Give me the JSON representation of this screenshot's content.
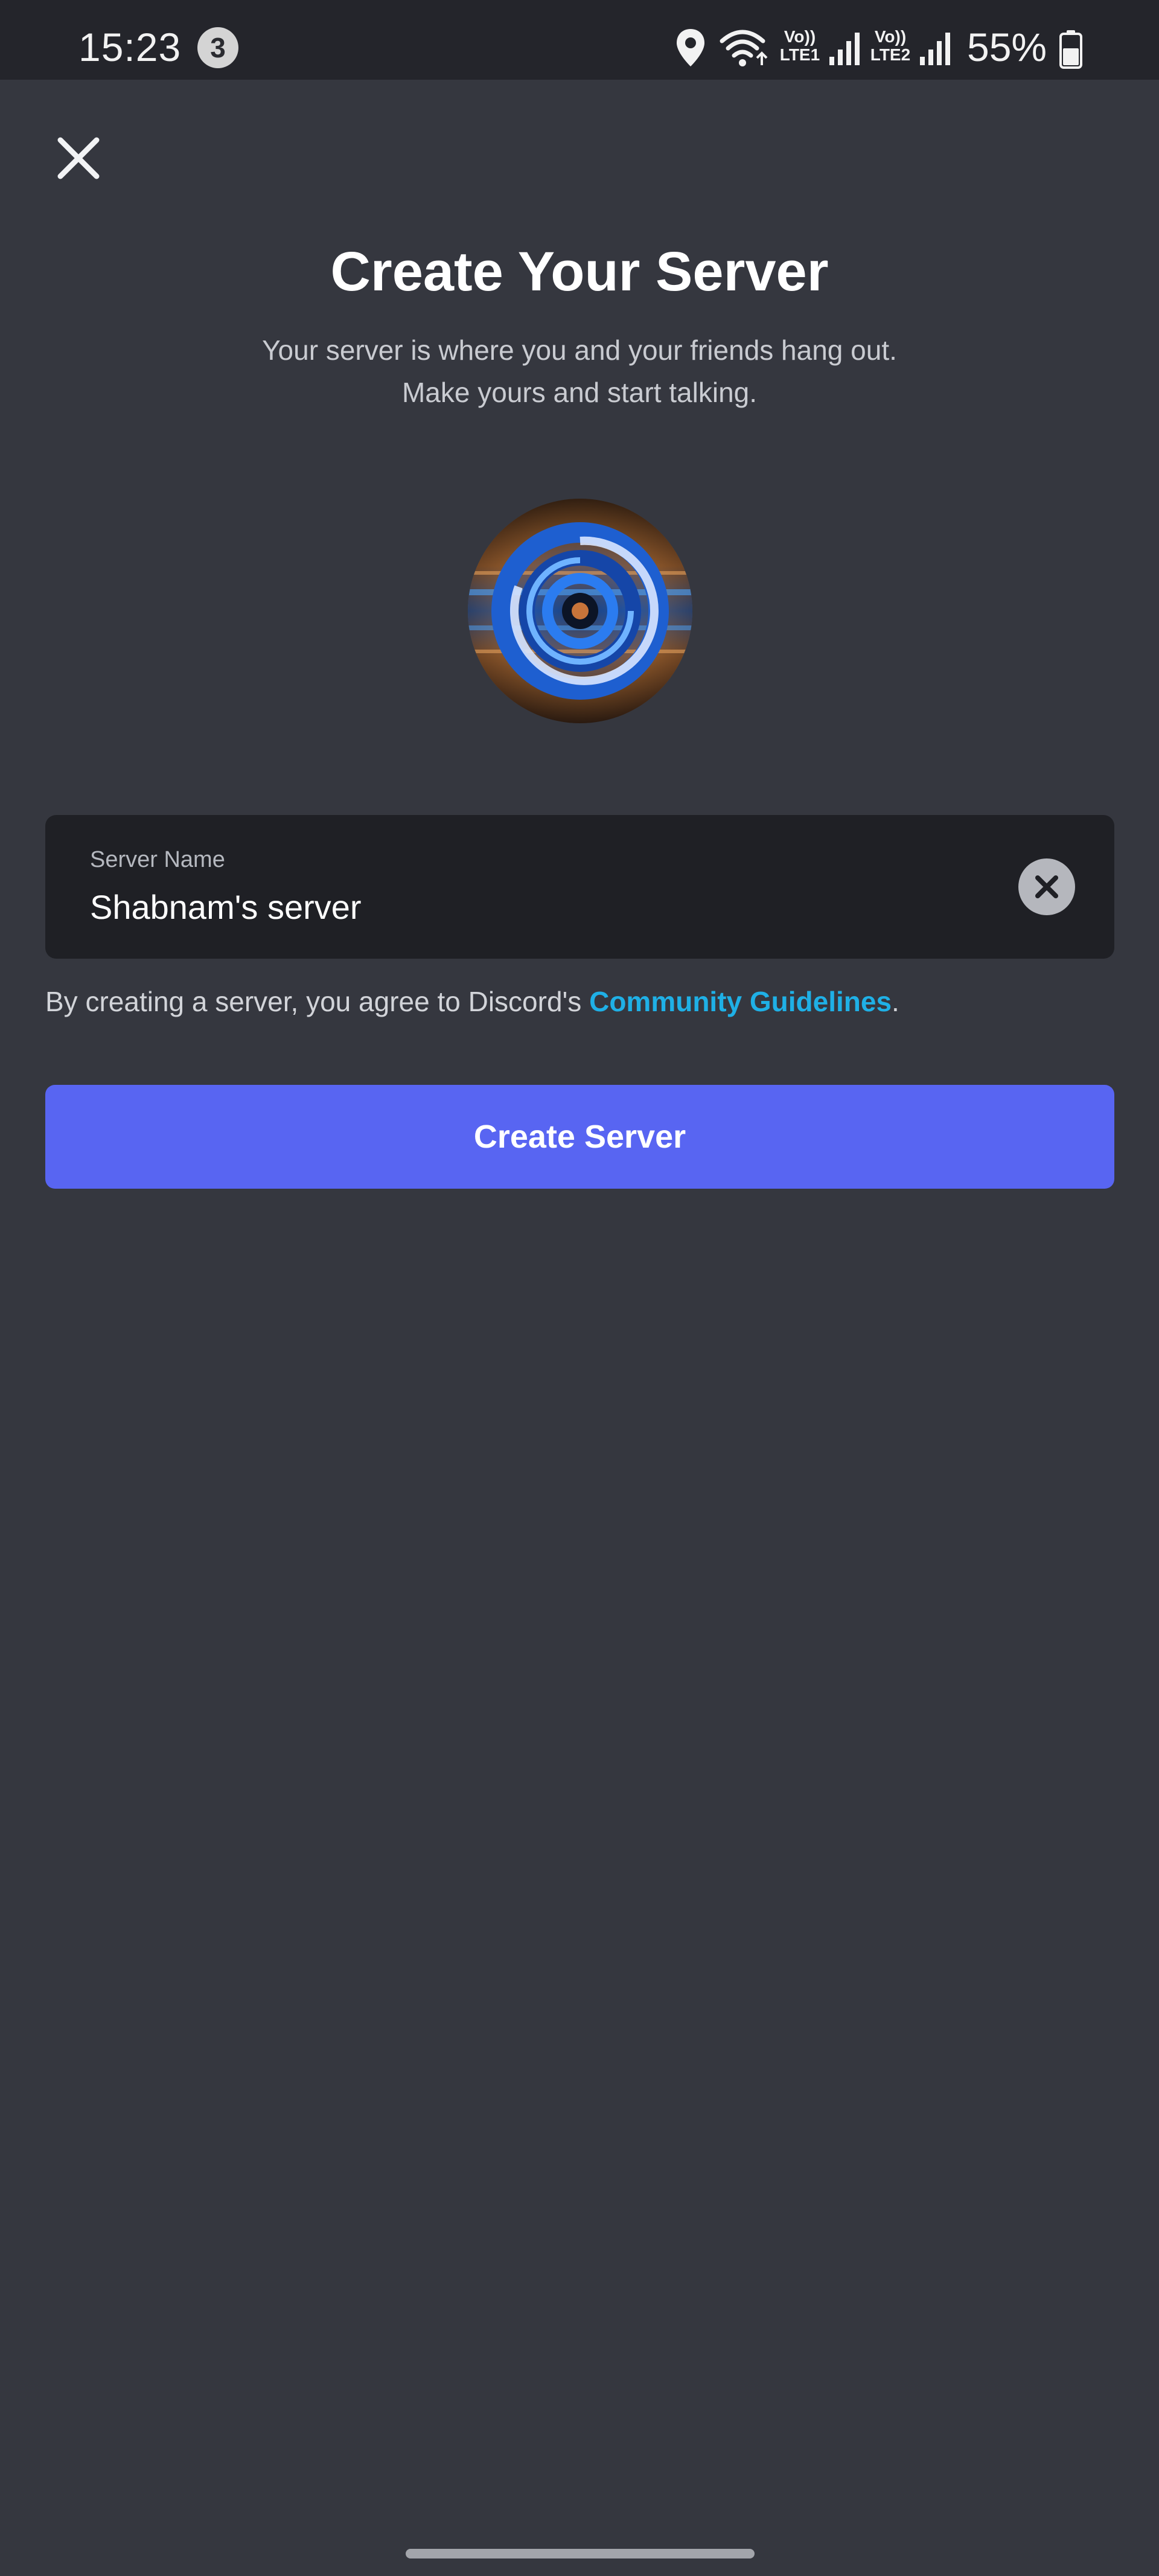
{
  "status_bar": {
    "time": "15:23",
    "notification_count": "3",
    "lte1_label_top": "Vo))",
    "lte1_label_bottom": "LTE1",
    "lte2_label_top": "Vo))",
    "lte2_label_bottom": "LTE2",
    "battery_percent": "55%"
  },
  "header": {
    "title": "Create Your Server",
    "subtitle_line1": "Your server is where you and your friends hang out.",
    "subtitle_line2": "Make yours and start talking."
  },
  "server_name_field": {
    "label": "Server Name",
    "value": "Shabnam's server"
  },
  "terms": {
    "prefix": "By creating a server, you agree to Discord's ",
    "link_text": "Community Guidelines",
    "suffix": "."
  },
  "actions": {
    "create_label": "Create Server"
  },
  "icons": {
    "close": "close-icon",
    "clear": "clear-input-icon",
    "location": "location-icon",
    "wifi": "wifi-icon",
    "signal": "signal-icon",
    "battery": "battery-icon"
  },
  "colors": {
    "background": "#35373f",
    "status_bar": "#24252b",
    "input_background": "#1f2025",
    "primary_button": "#5865f2",
    "link": "#1fb0e6"
  }
}
